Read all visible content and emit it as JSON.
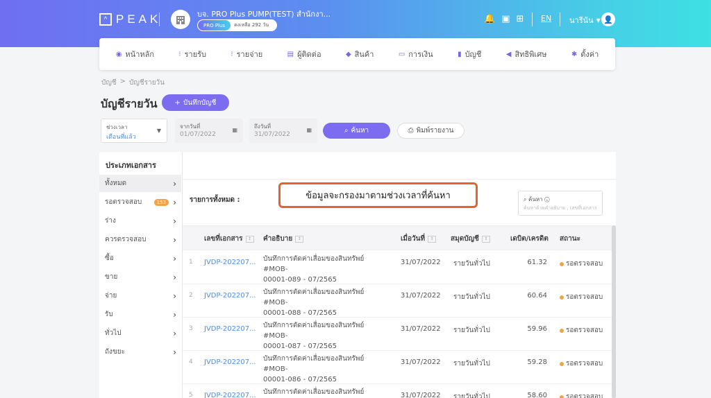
{
  "header": {
    "logo": "PEAK",
    "company_name": "บจ. PRO Plus PUMP(TEST) สำนักงา...",
    "plan": "PRO Plus",
    "days_left": "คงเหลือ 292 วัน",
    "language": "EN",
    "user_name": "นารีนัน"
  },
  "nav": [
    {
      "label": "หน้าหลัก"
    },
    {
      "label": "รายรับ"
    },
    {
      "label": "รายจ่าย"
    },
    {
      "label": "ผู้ติดต่อ"
    },
    {
      "label": "สินค้า"
    },
    {
      "label": "การเงิน"
    },
    {
      "label": "บัญชี"
    },
    {
      "label": "สิทธิพิเศษ"
    },
    {
      "label": "ตั้งค่า"
    }
  ],
  "breadcrumb": {
    "parent": "บัญชี",
    "sep": ">",
    "current": "บัญชีรายวัน"
  },
  "page": {
    "title": "บัญชีรายวัน",
    "record_button": "บันทึกบัญชี"
  },
  "filters": {
    "period_label": "ช่วงเวลา",
    "period_value": "เดือนที่แล้ว",
    "from_label": "จากวันที่",
    "from_value": "01/07/2022",
    "to_label": "ถึงวันที่",
    "to_value": "31/07/2022",
    "search_button": "ค้นหา",
    "print_button": "พิมพ์รายงาน"
  },
  "doc_types": {
    "heading": "ประเภทเอกสาร",
    "items": [
      {
        "label": "ทั้งหมด"
      },
      {
        "label": "รอตรวจสอบ",
        "badge": "153"
      },
      {
        "label": "ร่าง"
      },
      {
        "label": "ควรตรวจสอบ"
      },
      {
        "label": "ซื้อ"
      },
      {
        "label": "ขาย"
      },
      {
        "label": "จ่าย"
      },
      {
        "label": "รับ"
      },
      {
        "label": "ทั่วไป"
      },
      {
        "label": "ถังขยะ"
      }
    ]
  },
  "list": {
    "label": "รายการทั้งหมด :",
    "search_label": "ค้นหา",
    "search_placeholder": "ค้นหาด้วยคำอธิบาย , เลขที่เอกสาร",
    "callout": "ข้อมูลจะกรองมาตามช่วงเวลาที่ค้นหา",
    "columns": [
      "เลขที่เอกสาร",
      "คำอธิบาย",
      "เมื่อวันที่",
      "สมุดบัญชี",
      "เดบิต/เครดิต",
      "สถานะ"
    ],
    "rows": [
      {
        "no": "1",
        "doc": "JVDP-202207...",
        "desc1": "บันทึกการตัดค่าเสื่อมของสินทรัพย์ #MOB-",
        "desc2": "00001-089 - 07/2565",
        "date": "31/07/2022",
        "book": "รายวันทั่วไป",
        "amount": "61.32",
        "status": "รอตรวจสอบ"
      },
      {
        "no": "2",
        "doc": "JVDP-202207...",
        "desc1": "บันทึกการตัดค่าเสื่อมของสินทรัพย์ #MOB-",
        "desc2": "00001-088 - 07/2565",
        "date": "31/07/2022",
        "book": "รายวันทั่วไป",
        "amount": "60.64",
        "status": "รอตรวจสอบ"
      },
      {
        "no": "3",
        "doc": "JVDP-202207...",
        "desc1": "บันทึกการตัดค่าเสื่อมของสินทรัพย์ #MOB-",
        "desc2": "00001-087 - 07/2565",
        "date": "31/07/2022",
        "book": "รายวันทั่วไป",
        "amount": "59.96",
        "status": "รอตรวจสอบ"
      },
      {
        "no": "4",
        "doc": "JVDP-202207...",
        "desc1": "บันทึกการตัดค่าเสื่อมของสินทรัพย์ #MOB-",
        "desc2": "00001-086 - 07/2565",
        "date": "31/07/2022",
        "book": "รายวันทั่วไป",
        "amount": "59.28",
        "status": "รอตรวจสอบ"
      },
      {
        "no": "5",
        "doc": "JVDP-202207...",
        "desc1": "บันทึกการตัดค่าเสื่อมของสินทรัพย์ #MOB-",
        "desc2": "",
        "date": "31/07/2022",
        "book": "รายวันทั่วไป",
        "amount": "58.60",
        "status": "รอตรวจสอบ"
      }
    ]
  },
  "colors": {
    "accent": "#7b6cf0",
    "status": "#f3a249",
    "callout_border": "#e6622f",
    "link": "#4a90e2"
  }
}
